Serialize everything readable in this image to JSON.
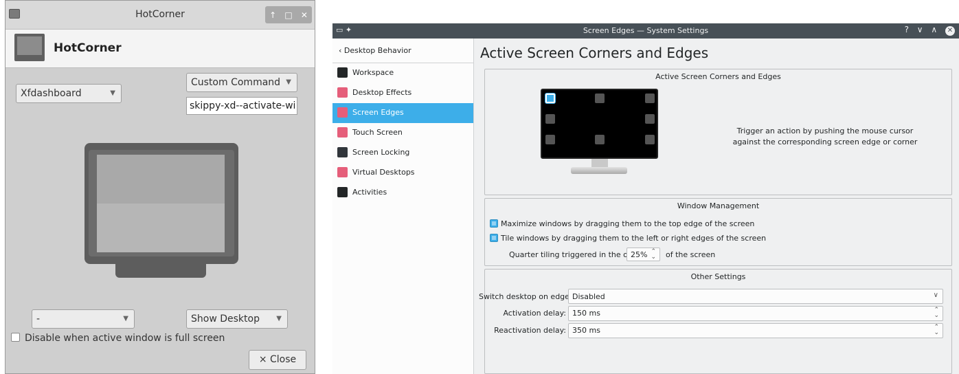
{
  "hotcorner": {
    "window_title": "HotCorner",
    "title_buttons": [
      "↑",
      "□",
      "✕"
    ],
    "app_name": "HotCorner",
    "top_left_action": "Xfdashboard",
    "top_right_action": "Custom Command",
    "custom_command_value": "skippy-xd--activate-wi",
    "bottom_left_action": "-",
    "bottom_right_action": "Show Desktop",
    "fullscreen_checkbox_label": "Disable when active window is full screen",
    "fullscreen_checkbox_checked": false,
    "close_label": "Close",
    "close_icon": "×",
    "dropdown_arrow": "▼"
  },
  "settings": {
    "window_title": "Screen Edges — System Settings",
    "title_left_icons": "▭ ✦",
    "title_right_icons": "? ∨ ∧",
    "title_close_icon": "✕",
    "back_icon": "‹",
    "back_label": "Desktop Behavior",
    "sidebar_items": [
      {
        "label": "Workspace",
        "icon": "workspace-icon",
        "color": "#232627"
      },
      {
        "label": "Desktop Effects",
        "icon": "desktop-effects-icon",
        "color": "#e55e7a"
      },
      {
        "label": "Screen Edges",
        "icon": "screen-edges-icon",
        "color": "#e55e7a",
        "selected": true
      },
      {
        "label": "Touch Screen",
        "icon": "touch-screen-icon",
        "color": "#e55e7a"
      },
      {
        "label": "Screen Locking",
        "icon": "screen-locking-icon",
        "color": "#31363b"
      },
      {
        "label": "Virtual Desktops",
        "icon": "virtual-desktops-icon",
        "color": "#e55e7a"
      },
      {
        "label": "Activities",
        "icon": "activities-icon",
        "color": "#232627"
      }
    ],
    "page_title": "Active Screen Corners and Edges",
    "corners_group_title": "Active Screen Corners and Edges",
    "corners_hint": "Trigger an action by pushing the mouse cursor against the corresponding screen edge or corner",
    "window_mgmt_title": "Window Management",
    "maximize_label": "Maximize windows by dragging them to the top edge of the screen",
    "maximize_checked": true,
    "tile_label": "Tile windows by dragging them to the left or right edges of the screen",
    "tile_checked": true,
    "quarter_label_before": "Quarter tiling triggered in the outer",
    "quarter_value": "25%",
    "quarter_label_after": "of the screen",
    "other_title": "Other Settings",
    "switch_desktop_label": "Switch desktop on edge:",
    "switch_desktop_value": "Disabled",
    "activation_delay_label": "Activation delay:",
    "activation_delay_value": "150 ms",
    "reactivation_delay_label": "Reactivation delay:",
    "reactivation_delay_value": "350 ms",
    "accent_color": "#3daee9",
    "spin_up": "⌃",
    "spin_down": "⌄",
    "combo_arrow": "∨"
  }
}
